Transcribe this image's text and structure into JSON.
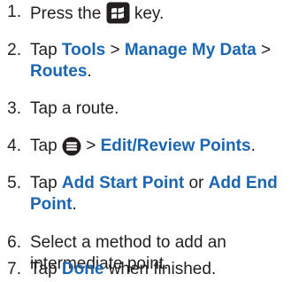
{
  "steps": [
    {
      "num": "1.",
      "pre": "Press the",
      "icon": "windows-key-icon",
      "post": " key."
    },
    {
      "num": "2.",
      "t1": "Tap ",
      "k1": "Tools",
      "sep1": " > ",
      "k2": "Manage My Data",
      "sep2": " >",
      "k3": "Routes",
      "end": "."
    },
    {
      "num": "3.",
      "text": "Tap a route."
    },
    {
      "num": "4.",
      "t1": "Tap ",
      "icon": "menu-icon",
      "sep": " > ",
      "k1": "Edit/Review Points",
      "end": "."
    },
    {
      "num": "5.",
      "t1": "Tap ",
      "k1": "Add Start Point",
      "mid": " or ",
      "k2a": "Add End",
      "k2b": "Point",
      "end": "."
    },
    {
      "num": "6.",
      "line1": "Select a method to add an",
      "line2": "intermediate point."
    },
    {
      "num": "7.",
      "t1": "Tap ",
      "k1": "Done",
      "end": " when finished."
    }
  ],
  "colors": {
    "text": "#231f20",
    "keyword": "#1a66b3",
    "icon_bg": "#231f20"
  }
}
